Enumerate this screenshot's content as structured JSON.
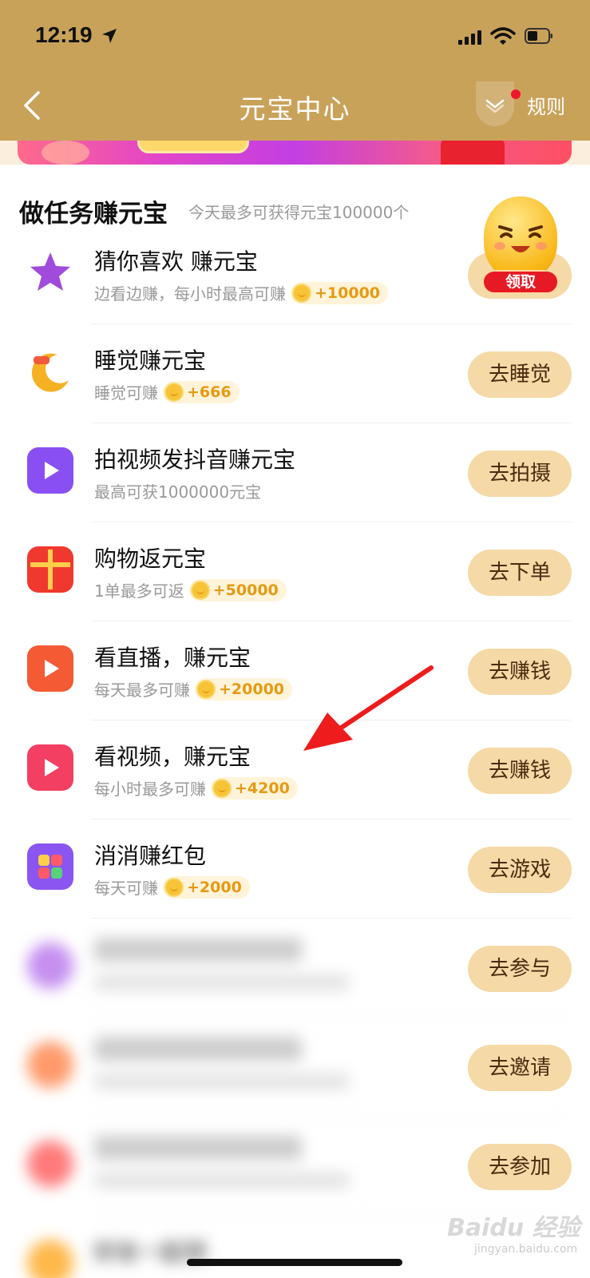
{
  "status_bar": {
    "time": "12:19"
  },
  "nav": {
    "title": "元宝中心",
    "rules": "规则"
  },
  "section": {
    "title": "做任务赚元宝",
    "subtitle": "今天最多可获得元宝100000个"
  },
  "mascot": {
    "badge": "领取"
  },
  "tasks": [
    {
      "title": "猜你喜欢 赚元宝",
      "desc": "边看边赚，每小时最高可赚",
      "reward": "+10000",
      "button": "",
      "icon": "star-icon",
      "color": "#a04bdc"
    },
    {
      "title": "睡觉赚元宝",
      "desc": "睡觉可赚",
      "reward": "+666",
      "button": "去睡觉",
      "icon": "moon-icon",
      "color": "#f6b122"
    },
    {
      "title": "拍视频发抖音赚元宝",
      "desc": "最高可获1000000元宝",
      "reward": "",
      "button": "去拍摄",
      "icon": "video-gift-icon",
      "color": "#8a4ff2"
    },
    {
      "title": "购物返元宝",
      "desc": "1单最多可返",
      "reward": "+50000",
      "button": "去下单",
      "icon": "gift-box-icon",
      "color": "#f0392e"
    },
    {
      "title": "看直播，赚元宝",
      "desc": "每天最多可赚",
      "reward": "+20000",
      "button": "去赚钱",
      "icon": "tv-icon",
      "color": "#f45a34"
    },
    {
      "title": "看视频，赚元宝",
      "desc": "每小时最多可赚",
      "reward": "+4200",
      "button": "去赚钱",
      "icon": "video-camera-icon",
      "color": "#f23f62"
    },
    {
      "title": "消消赚红包",
      "desc": "每天可赚",
      "reward": "+2000",
      "button": "去游戏",
      "icon": "puzzle-icon",
      "color": "#8a55f0"
    },
    {
      "title": "",
      "desc": "",
      "reward": "",
      "button": "去参与",
      "icon": "blurred-icon",
      "color": "#c58ff0"
    },
    {
      "title": "",
      "desc": "",
      "reward": "",
      "button": "去邀请",
      "icon": "blurred-icon",
      "color": "#ff9a6a"
    },
    {
      "title": "",
      "desc": "",
      "reward": "",
      "button": "去参加",
      "icon": "blurred-icon",
      "color": "#ff7a7a"
    },
    {
      "title": "好友一起领",
      "desc": "",
      "reward": "",
      "button": "",
      "icon": "blurred-icon",
      "color": "#ffb84a"
    }
  ],
  "watermark": {
    "main": "Baidu 经验",
    "sub": "jingyan.baidu.com"
  },
  "colors": {
    "header": "#c9a25a",
    "button": "#f5d9a6",
    "accent": "#e69a14"
  }
}
